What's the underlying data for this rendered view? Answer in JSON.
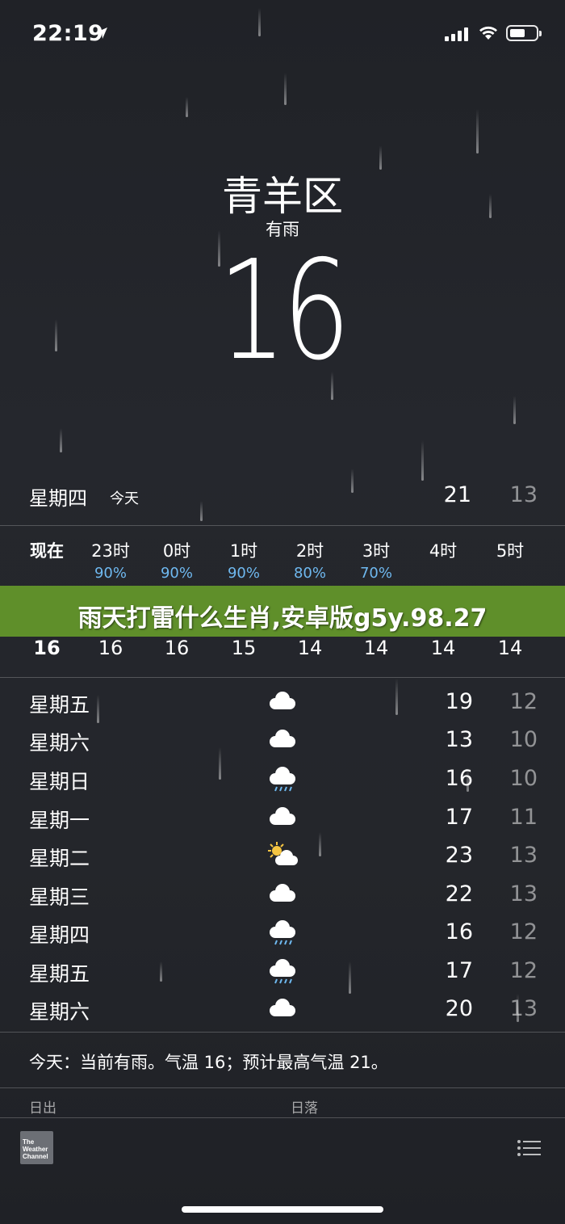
{
  "status_bar": {
    "time": "22:19"
  },
  "header": {
    "city": "青羊区",
    "condition": "有雨",
    "temperature": "16"
  },
  "today": {
    "day": "星期四",
    "label": "今天",
    "high": "21",
    "low": "13"
  },
  "hourly": [
    {
      "label": "现在",
      "pop": "",
      "temp": "16"
    },
    {
      "label": "23时",
      "pop": "90%",
      "temp": "16"
    },
    {
      "label": "0时",
      "pop": "90%",
      "temp": "16"
    },
    {
      "label": "1时",
      "pop": "90%",
      "temp": "15"
    },
    {
      "label": "2时",
      "pop": "80%",
      "temp": "14"
    },
    {
      "label": "3时",
      "pop": "70%",
      "temp": "14"
    },
    {
      "label": "4时",
      "pop": "",
      "temp": "14"
    },
    {
      "label": "5时",
      "pop": "",
      "temp": "14"
    }
  ],
  "banner": {
    "text": "雨天打雷什么生肖,安卓版g5y.98.27"
  },
  "daily": [
    {
      "day": "星期五",
      "icon": "cloud-icon",
      "high": "19",
      "low": "12"
    },
    {
      "day": "星期六",
      "icon": "cloud-icon",
      "high": "13",
      "low": "10"
    },
    {
      "day": "星期日",
      "icon": "rain-icon",
      "high": "16",
      "low": "10"
    },
    {
      "day": "星期一",
      "icon": "cloud-icon",
      "high": "17",
      "low": "11"
    },
    {
      "day": "星期二",
      "icon": "partly-sunny-icon",
      "high": "23",
      "low": "13"
    },
    {
      "day": "星期三",
      "icon": "cloud-icon",
      "high": "22",
      "low": "13"
    },
    {
      "day": "星期四",
      "icon": "rain-icon",
      "high": "16",
      "low": "12"
    },
    {
      "day": "星期五",
      "icon": "rain-icon",
      "high": "17",
      "low": "12"
    },
    {
      "day": "星期六",
      "icon": "cloud-icon",
      "high": "20",
      "low": "13"
    }
  ],
  "summary": "今天：当前有雨。气温 16；预计最高气温 21。",
  "sun": {
    "sunrise_label": "日出",
    "sunset_label": "日落"
  },
  "footer": {
    "logo_text": "The Weather Channel"
  },
  "colors": {
    "precip_blue": "#6fb9f0",
    "banner_green": "#5f8f2a"
  }
}
